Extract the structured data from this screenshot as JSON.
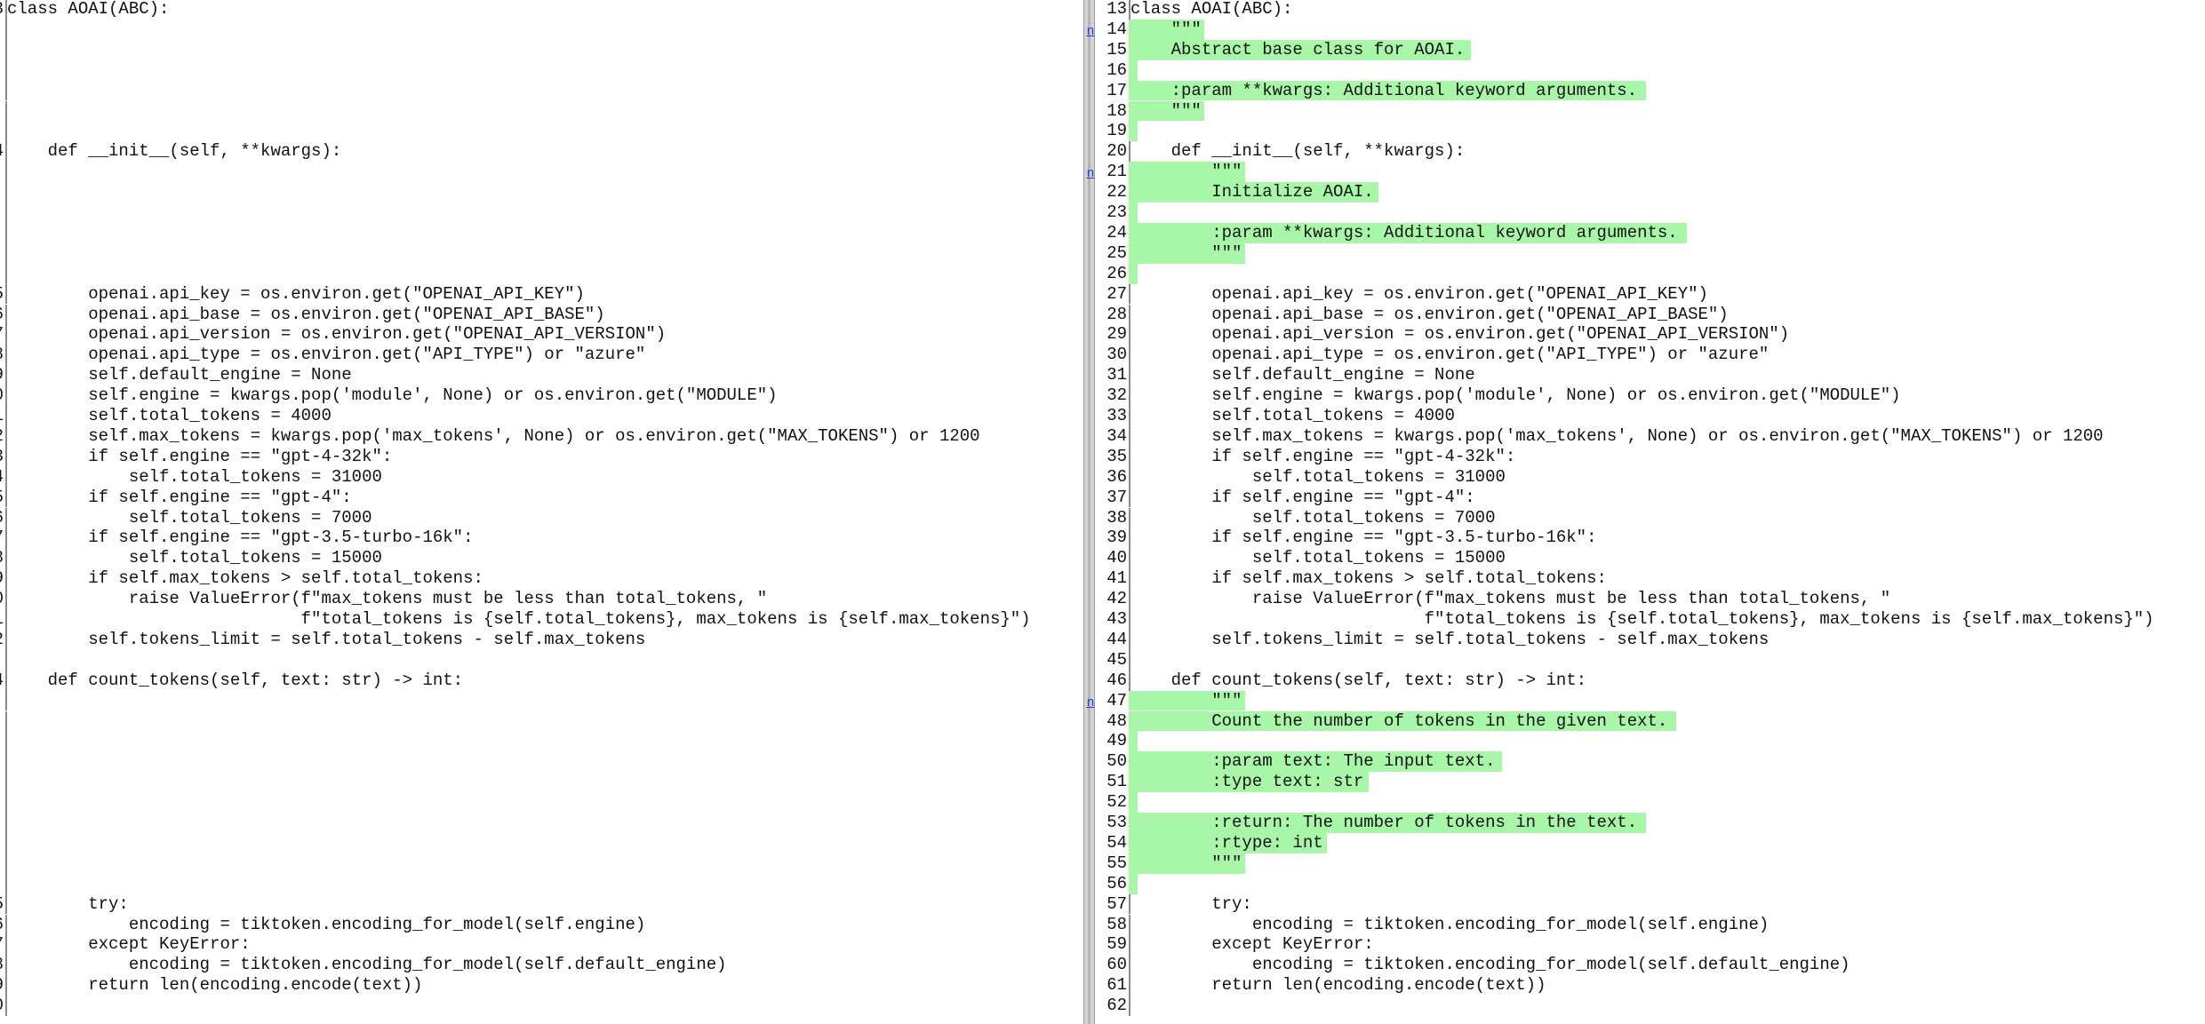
{
  "left": {
    "rows": [
      {
        "num": "3",
        "code": "class AOAI(ABC):"
      },
      {
        "num": "",
        "code": ""
      },
      {
        "num": "",
        "code": ""
      },
      {
        "num": "",
        "code": ""
      },
      {
        "num": "",
        "code": ""
      },
      {
        "num": "",
        "code": ""
      },
      {
        "num": "",
        "code": ""
      },
      {
        "num": "4",
        "code": "    def __init__(self, **kwargs):"
      },
      {
        "num": "",
        "code": ""
      },
      {
        "num": "",
        "code": ""
      },
      {
        "num": "",
        "code": ""
      },
      {
        "num": "",
        "code": ""
      },
      {
        "num": "",
        "code": ""
      },
      {
        "num": "",
        "code": ""
      },
      {
        "num": "5",
        "code": "        openai.api_key = os.environ.get(\"OPENAI_API_KEY\")"
      },
      {
        "num": "6",
        "code": "        openai.api_base = os.environ.get(\"OPENAI_API_BASE\")"
      },
      {
        "num": "7",
        "code": "        openai.api_version = os.environ.get(\"OPENAI_API_VERSION\")"
      },
      {
        "num": "8",
        "code": "        openai.api_type = os.environ.get(\"API_TYPE\") or \"azure\""
      },
      {
        "num": "9",
        "code": "        self.default_engine = None"
      },
      {
        "num": "0",
        "code": "        self.engine = kwargs.pop('module', None) or os.environ.get(\"MODULE\")"
      },
      {
        "num": "1",
        "code": "        self.total_tokens = 4000"
      },
      {
        "num": "2",
        "code": "        self.max_tokens = kwargs.pop('max_tokens', None) or os.environ.get(\"MAX_TOKENS\") or 1200"
      },
      {
        "num": "3",
        "code": "        if self.engine == \"gpt-4-32k\":"
      },
      {
        "num": "4",
        "code": "            self.total_tokens = 31000"
      },
      {
        "num": "5",
        "code": "        if self.engine == \"gpt-4\":"
      },
      {
        "num": "6",
        "code": "            self.total_tokens = 7000"
      },
      {
        "num": "7",
        "code": "        if self.engine == \"gpt-3.5-turbo-16k\":"
      },
      {
        "num": "8",
        "code": "            self.total_tokens = 15000"
      },
      {
        "num": "9",
        "code": "        if self.max_tokens > self.total_tokens:"
      },
      {
        "num": "0",
        "code": "            raise ValueError(f\"max_tokens must be less than total_tokens, \""
      },
      {
        "num": "1",
        "code": "                             f\"total_tokens is {self.total_tokens}, max_tokens is {self.max_tokens}\")"
      },
      {
        "num": "2",
        "code": "        self.tokens_limit = self.total_tokens - self.max_tokens"
      },
      {
        "num": "",
        "code": ""
      },
      {
        "num": "4",
        "code": "    def count_tokens(self, text: str) -> int:"
      },
      {
        "num": "",
        "code": ""
      },
      {
        "num": "",
        "code": ""
      },
      {
        "num": "",
        "code": ""
      },
      {
        "num": "",
        "code": ""
      },
      {
        "num": "",
        "code": ""
      },
      {
        "num": "",
        "code": ""
      },
      {
        "num": "",
        "code": ""
      },
      {
        "num": "",
        "code": ""
      },
      {
        "num": "",
        "code": ""
      },
      {
        "num": "",
        "code": ""
      },
      {
        "num": "5",
        "code": "        try:"
      },
      {
        "num": "6",
        "code": "            encoding = tiktoken.encoding_for_model(self.engine)"
      },
      {
        "num": "7",
        "code": "        except KeyError:"
      },
      {
        "num": "8",
        "code": "            encoding = tiktoken.encoding_for_model(self.default_engine)"
      },
      {
        "num": "9",
        "code": "        return len(encoding.encode(text))"
      },
      {
        "num": "0",
        "code": ""
      }
    ]
  },
  "right": {
    "rows": [
      {
        "num": "13",
        "code": "class AOAI(ABC):",
        "added": false
      },
      {
        "num": "14",
        "code": "    \"\"\"",
        "added": true
      },
      {
        "num": "15",
        "code": "    Abstract base class for AOAI.",
        "added": true
      },
      {
        "num": "16",
        "code": "",
        "added": true
      },
      {
        "num": "17",
        "code": "    :param **kwargs: Additional keyword arguments.",
        "added": true
      },
      {
        "num": "18",
        "code": "    \"\"\"",
        "added": true
      },
      {
        "num": "19",
        "code": "",
        "added": true
      },
      {
        "num": "20",
        "code": "    def __init__(self, **kwargs):",
        "added": false
      },
      {
        "num": "21",
        "code": "        \"\"\"",
        "added": true
      },
      {
        "num": "22",
        "code": "        Initialize AOAI.",
        "added": true
      },
      {
        "num": "23",
        "code": "",
        "added": true
      },
      {
        "num": "24",
        "code": "        :param **kwargs: Additional keyword arguments.",
        "added": true
      },
      {
        "num": "25",
        "code": "        \"\"\"",
        "added": true
      },
      {
        "num": "26",
        "code": "",
        "added": true
      },
      {
        "num": "27",
        "code": "        openai.api_key = os.environ.get(\"OPENAI_API_KEY\")",
        "added": false
      },
      {
        "num": "28",
        "code": "        openai.api_base = os.environ.get(\"OPENAI_API_BASE\")",
        "added": false
      },
      {
        "num": "29",
        "code": "        openai.api_version = os.environ.get(\"OPENAI_API_VERSION\")",
        "added": false
      },
      {
        "num": "30",
        "code": "        openai.api_type = os.environ.get(\"API_TYPE\") or \"azure\"",
        "added": false
      },
      {
        "num": "31",
        "code": "        self.default_engine = None",
        "added": false
      },
      {
        "num": "32",
        "code": "        self.engine = kwargs.pop('module', None) or os.environ.get(\"MODULE\")",
        "added": false
      },
      {
        "num": "33",
        "code": "        self.total_tokens = 4000",
        "added": false
      },
      {
        "num": "34",
        "code": "        self.max_tokens = kwargs.pop('max_tokens', None) or os.environ.get(\"MAX_TOKENS\") or 1200",
        "added": false
      },
      {
        "num": "35",
        "code": "        if self.engine == \"gpt-4-32k\":",
        "added": false
      },
      {
        "num": "36",
        "code": "            self.total_tokens = 31000",
        "added": false
      },
      {
        "num": "37",
        "code": "        if self.engine == \"gpt-4\":",
        "added": false
      },
      {
        "num": "38",
        "code": "            self.total_tokens = 7000",
        "added": false
      },
      {
        "num": "39",
        "code": "        if self.engine == \"gpt-3.5-turbo-16k\":",
        "added": false
      },
      {
        "num": "40",
        "code": "            self.total_tokens = 15000",
        "added": false
      },
      {
        "num": "41",
        "code": "        if self.max_tokens > self.total_tokens:",
        "added": false
      },
      {
        "num": "42",
        "code": "            raise ValueError(f\"max_tokens must be less than total_tokens, \"",
        "added": false
      },
      {
        "num": "43",
        "code": "                             f\"total_tokens is {self.total_tokens}, max_tokens is {self.max_tokens}\")",
        "added": false
      },
      {
        "num": "44",
        "code": "        self.tokens_limit = self.total_tokens - self.max_tokens",
        "added": false
      },
      {
        "num": "45",
        "code": "",
        "added": false
      },
      {
        "num": "46",
        "code": "    def count_tokens(self, text: str) -> int:",
        "added": false
      },
      {
        "num": "47",
        "code": "        \"\"\"",
        "added": true
      },
      {
        "num": "48",
        "code": "        Count the number of tokens in the given text.",
        "added": true
      },
      {
        "num": "49",
        "code": "",
        "added": true
      },
      {
        "num": "50",
        "code": "        :param text: The input text.",
        "added": true
      },
      {
        "num": "51",
        "code": "        :type text: str",
        "added": true
      },
      {
        "num": "52",
        "code": "",
        "added": true
      },
      {
        "num": "53",
        "code": "        :return: The number of tokens in the text.",
        "added": true
      },
      {
        "num": "54",
        "code": "        :rtype: int",
        "added": true
      },
      {
        "num": "55",
        "code": "        \"\"\"",
        "added": true
      },
      {
        "num": "56",
        "code": "",
        "added": true
      },
      {
        "num": "57",
        "code": "        try:",
        "added": false
      },
      {
        "num": "58",
        "code": "            encoding = tiktoken.encoding_for_model(self.engine)",
        "added": false
      },
      {
        "num": "59",
        "code": "        except KeyError:",
        "added": false
      },
      {
        "num": "60",
        "code": "            encoding = tiktoken.encoding_for_model(self.default_engine)",
        "added": false
      },
      {
        "num": "61",
        "code": "        return len(encoding.encode(text))",
        "added": false
      },
      {
        "num": "62",
        "code": "",
        "added": false
      }
    ]
  },
  "anchors": [
    {
      "label": "n",
      "row": 1
    },
    {
      "label": "n",
      "row": 8
    },
    {
      "label": "n",
      "row": 34
    }
  ],
  "colors": {
    "added_bg": "#a8f7a8",
    "anchor_link": "#1a3fd1",
    "divider": "#d4d4d4"
  }
}
